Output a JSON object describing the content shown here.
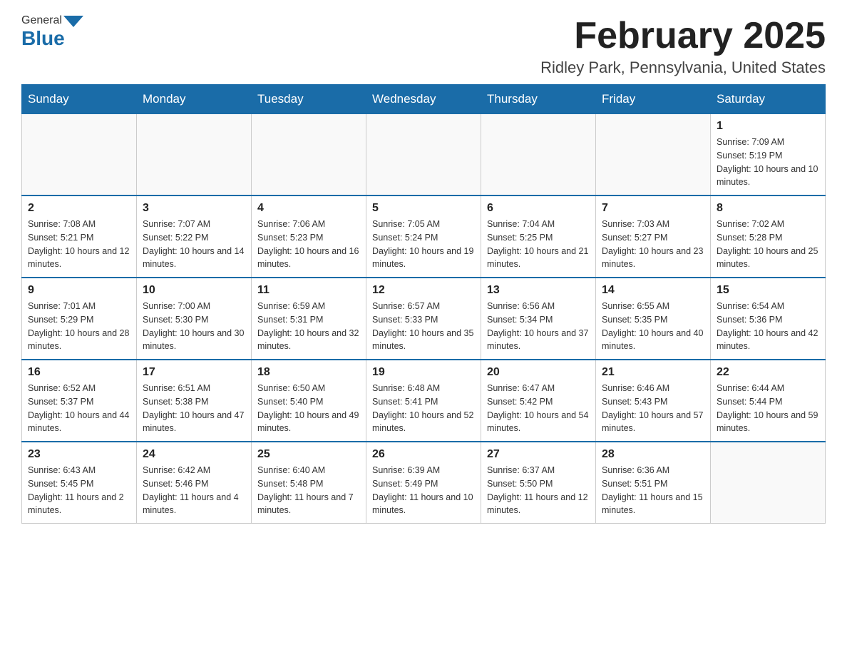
{
  "header": {
    "logo_general": "General",
    "logo_blue": "Blue",
    "month": "February 2025",
    "location": "Ridley Park, Pennsylvania, United States"
  },
  "weekdays": [
    "Sunday",
    "Monday",
    "Tuesday",
    "Wednesday",
    "Thursday",
    "Friday",
    "Saturday"
  ],
  "weeks": [
    [
      {
        "day": "",
        "info": ""
      },
      {
        "day": "",
        "info": ""
      },
      {
        "day": "",
        "info": ""
      },
      {
        "day": "",
        "info": ""
      },
      {
        "day": "",
        "info": ""
      },
      {
        "day": "",
        "info": ""
      },
      {
        "day": "1",
        "info": "Sunrise: 7:09 AM\nSunset: 5:19 PM\nDaylight: 10 hours and 10 minutes."
      }
    ],
    [
      {
        "day": "2",
        "info": "Sunrise: 7:08 AM\nSunset: 5:21 PM\nDaylight: 10 hours and 12 minutes."
      },
      {
        "day": "3",
        "info": "Sunrise: 7:07 AM\nSunset: 5:22 PM\nDaylight: 10 hours and 14 minutes."
      },
      {
        "day": "4",
        "info": "Sunrise: 7:06 AM\nSunset: 5:23 PM\nDaylight: 10 hours and 16 minutes."
      },
      {
        "day": "5",
        "info": "Sunrise: 7:05 AM\nSunset: 5:24 PM\nDaylight: 10 hours and 19 minutes."
      },
      {
        "day": "6",
        "info": "Sunrise: 7:04 AM\nSunset: 5:25 PM\nDaylight: 10 hours and 21 minutes."
      },
      {
        "day": "7",
        "info": "Sunrise: 7:03 AM\nSunset: 5:27 PM\nDaylight: 10 hours and 23 minutes."
      },
      {
        "day": "8",
        "info": "Sunrise: 7:02 AM\nSunset: 5:28 PM\nDaylight: 10 hours and 25 minutes."
      }
    ],
    [
      {
        "day": "9",
        "info": "Sunrise: 7:01 AM\nSunset: 5:29 PM\nDaylight: 10 hours and 28 minutes."
      },
      {
        "day": "10",
        "info": "Sunrise: 7:00 AM\nSunset: 5:30 PM\nDaylight: 10 hours and 30 minutes."
      },
      {
        "day": "11",
        "info": "Sunrise: 6:59 AM\nSunset: 5:31 PM\nDaylight: 10 hours and 32 minutes."
      },
      {
        "day": "12",
        "info": "Sunrise: 6:57 AM\nSunset: 5:33 PM\nDaylight: 10 hours and 35 minutes."
      },
      {
        "day": "13",
        "info": "Sunrise: 6:56 AM\nSunset: 5:34 PM\nDaylight: 10 hours and 37 minutes."
      },
      {
        "day": "14",
        "info": "Sunrise: 6:55 AM\nSunset: 5:35 PM\nDaylight: 10 hours and 40 minutes."
      },
      {
        "day": "15",
        "info": "Sunrise: 6:54 AM\nSunset: 5:36 PM\nDaylight: 10 hours and 42 minutes."
      }
    ],
    [
      {
        "day": "16",
        "info": "Sunrise: 6:52 AM\nSunset: 5:37 PM\nDaylight: 10 hours and 44 minutes."
      },
      {
        "day": "17",
        "info": "Sunrise: 6:51 AM\nSunset: 5:38 PM\nDaylight: 10 hours and 47 minutes."
      },
      {
        "day": "18",
        "info": "Sunrise: 6:50 AM\nSunset: 5:40 PM\nDaylight: 10 hours and 49 minutes."
      },
      {
        "day": "19",
        "info": "Sunrise: 6:48 AM\nSunset: 5:41 PM\nDaylight: 10 hours and 52 minutes."
      },
      {
        "day": "20",
        "info": "Sunrise: 6:47 AM\nSunset: 5:42 PM\nDaylight: 10 hours and 54 minutes."
      },
      {
        "day": "21",
        "info": "Sunrise: 6:46 AM\nSunset: 5:43 PM\nDaylight: 10 hours and 57 minutes."
      },
      {
        "day": "22",
        "info": "Sunrise: 6:44 AM\nSunset: 5:44 PM\nDaylight: 10 hours and 59 minutes."
      }
    ],
    [
      {
        "day": "23",
        "info": "Sunrise: 6:43 AM\nSunset: 5:45 PM\nDaylight: 11 hours and 2 minutes."
      },
      {
        "day": "24",
        "info": "Sunrise: 6:42 AM\nSunset: 5:46 PM\nDaylight: 11 hours and 4 minutes."
      },
      {
        "day": "25",
        "info": "Sunrise: 6:40 AM\nSunset: 5:48 PM\nDaylight: 11 hours and 7 minutes."
      },
      {
        "day": "26",
        "info": "Sunrise: 6:39 AM\nSunset: 5:49 PM\nDaylight: 11 hours and 10 minutes."
      },
      {
        "day": "27",
        "info": "Sunrise: 6:37 AM\nSunset: 5:50 PM\nDaylight: 11 hours and 12 minutes."
      },
      {
        "day": "28",
        "info": "Sunrise: 6:36 AM\nSunset: 5:51 PM\nDaylight: 11 hours and 15 minutes."
      },
      {
        "day": "",
        "info": ""
      }
    ]
  ]
}
